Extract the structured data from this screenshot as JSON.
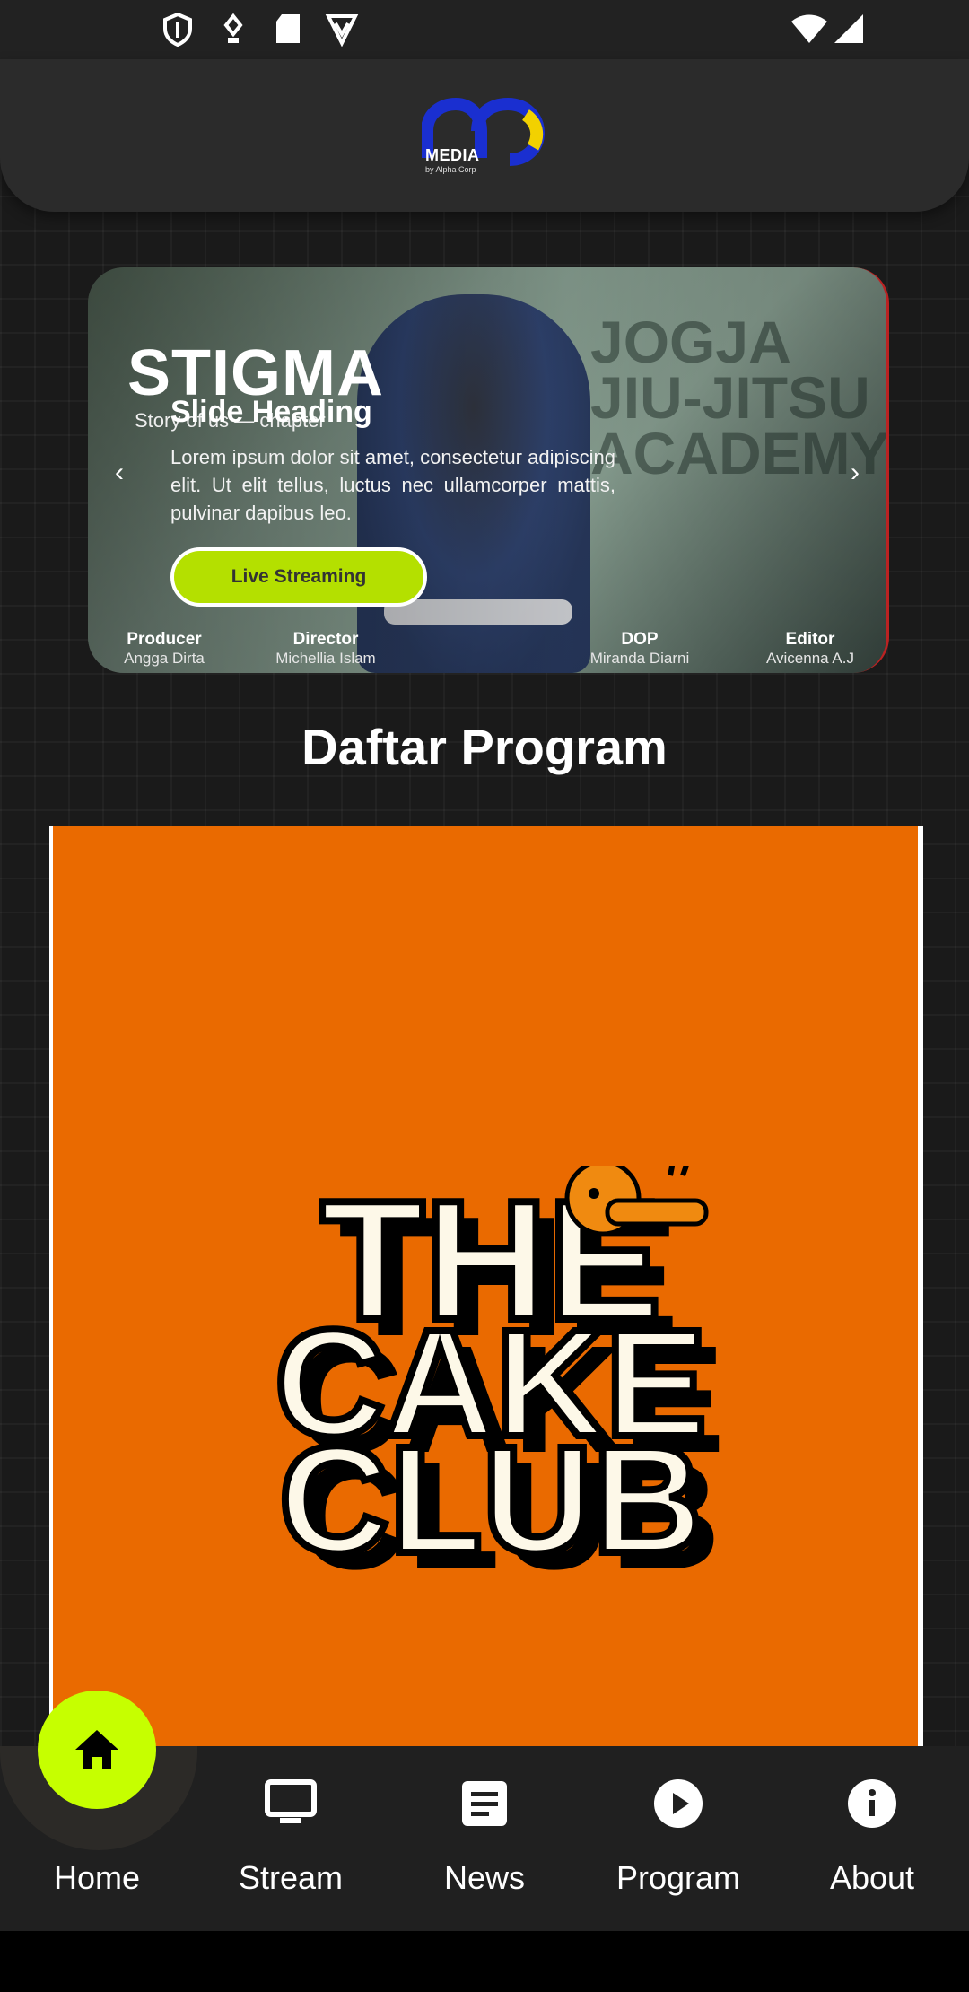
{
  "status_bar": {
    "icons": [
      "shield-icon",
      "sim-icon",
      "sd-card-icon",
      "vpn-icon",
      "wifi-icon",
      "signal-icon"
    ]
  },
  "header": {
    "logo_text": "MEDIA",
    "logo_subtext": "by Alpha Corp"
  },
  "slider": {
    "poster_title": "STIGMA",
    "poster_subtitle": "Story of us — chapter",
    "poster_brand": "JOGJA\nJIU-JITSU\nACADEMY",
    "heading": "Slide Heading",
    "text": "Lorem ipsum dolor sit amet, consectetur adipiscing elit. Ut elit tellus, luctus nec ullamcorper mattis, pulvinar dapibus leo.",
    "button_label": "Live Streaming",
    "prev_arrow": "‹",
    "next_arrow": "›",
    "credits": [
      {
        "role": "Producer",
        "name": "Angga Dirta"
      },
      {
        "role": "Director",
        "name": "Michellia Islam"
      },
      {
        "role": "DOP",
        "name": "Miranda Diarni"
      },
      {
        "role": "Editor",
        "name": "Avicenna A.J"
      }
    ]
  },
  "section": {
    "title": "Daftar Program"
  },
  "program": {
    "logo_lines": [
      "THE",
      "CAKE",
      "CLUB"
    ]
  },
  "bottom_nav": {
    "items": [
      {
        "label": "Home",
        "icon": "home-icon"
      },
      {
        "label": "Stream",
        "icon": "monitor-icon"
      },
      {
        "label": "News",
        "icon": "news-icon"
      },
      {
        "label": "Program",
        "icon": "play-icon"
      },
      {
        "label": "About",
        "icon": "info-icon"
      }
    ],
    "active_color": "#c6ff00"
  }
}
